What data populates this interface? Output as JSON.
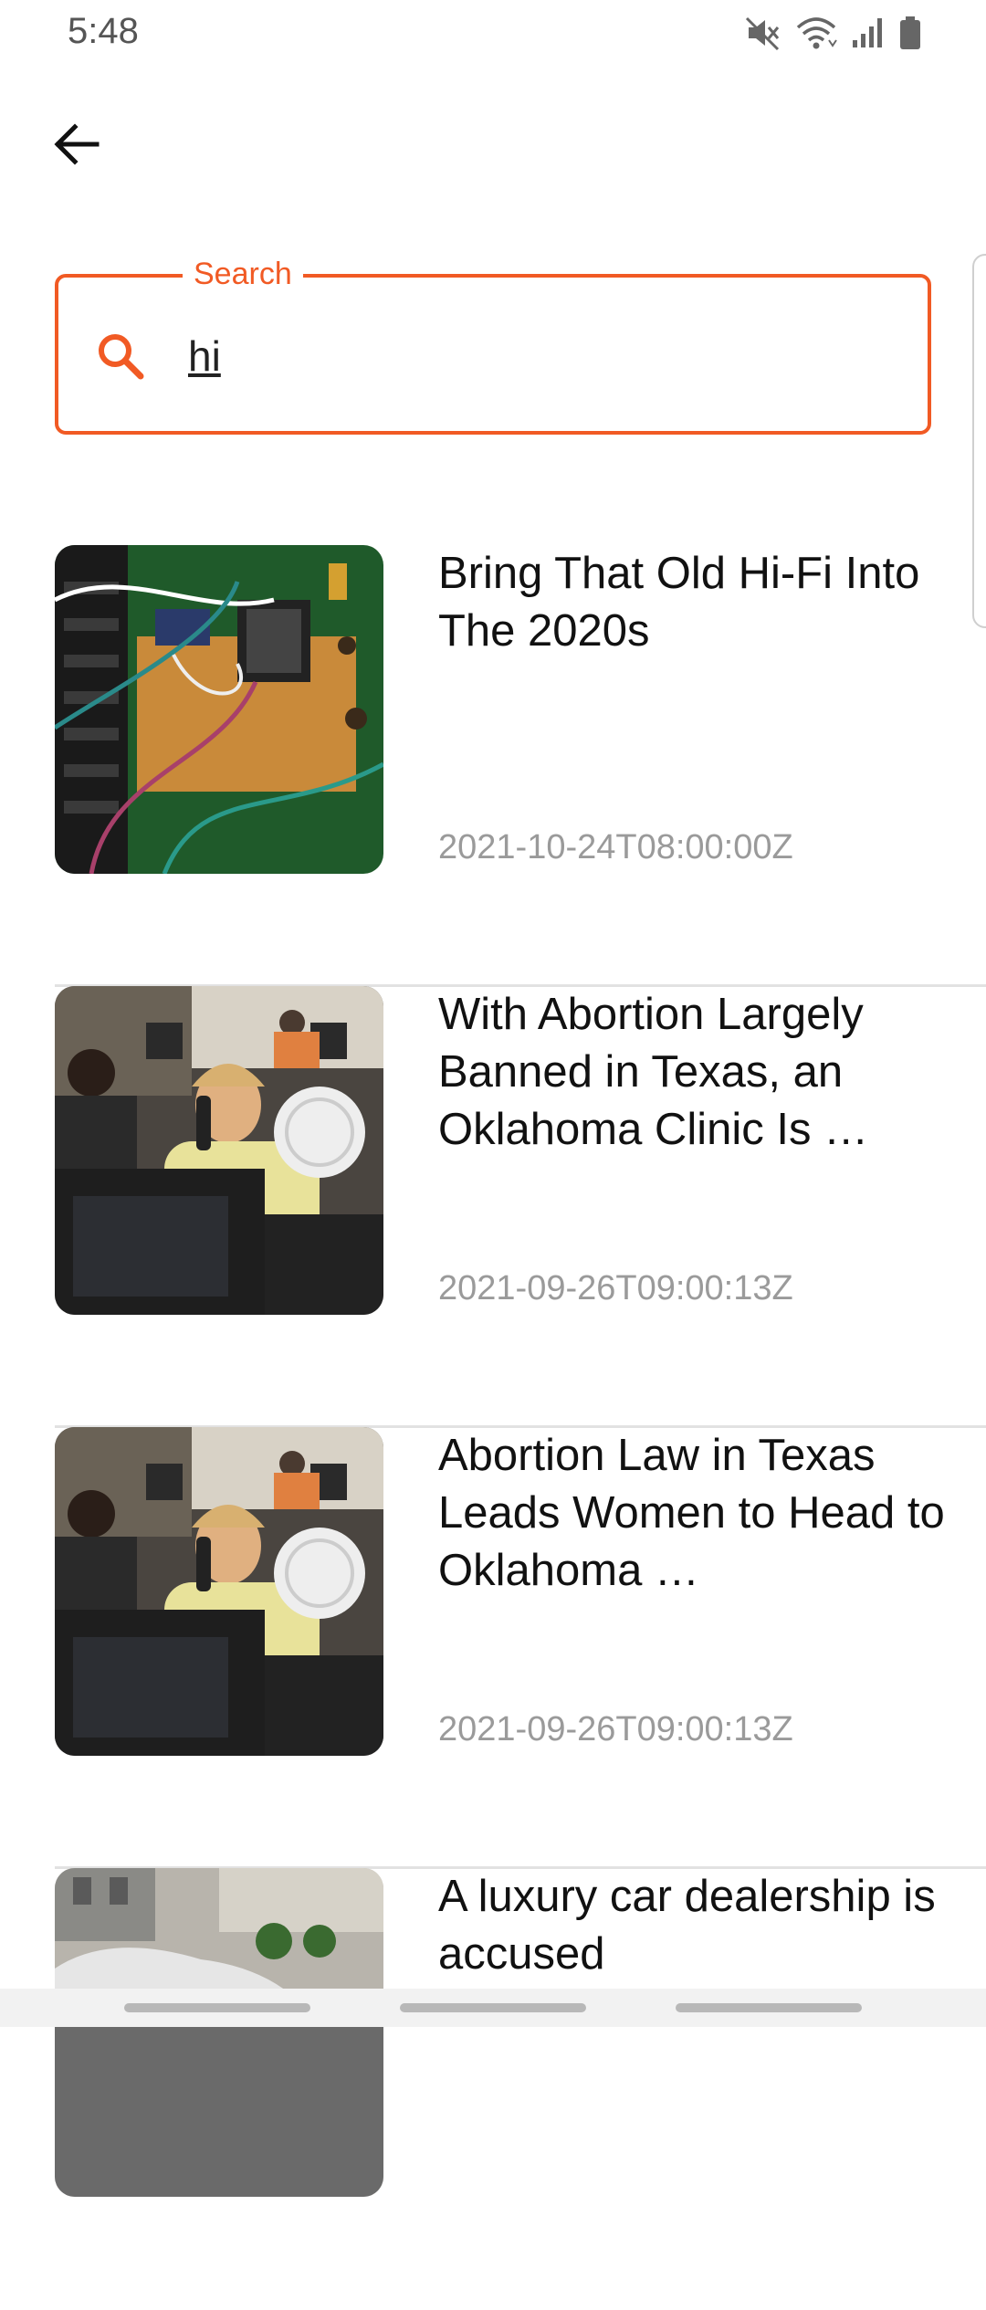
{
  "status_bar": {
    "time": "5:48",
    "icons": [
      "mute-icon",
      "wifi-icon",
      "signal-icon",
      "battery-icon"
    ]
  },
  "header": {
    "back_icon": "arrow-left-icon"
  },
  "search": {
    "label": "Search",
    "value": "hi",
    "icon": "search-icon",
    "accent_color": "#f15a24"
  },
  "articles": [
    {
      "title": "Bring That Old Hi-Fi Into The 2020s",
      "date": "2021-10-24T08:00:00Z",
      "image": "circuit-board-photo"
    },
    {
      "title": "With Abortion Largely Banned in Texas, an Oklahoma Clinic Is …",
      "date": "2021-09-26T09:00:13Z",
      "image": "clinic-phone-photo"
    },
    {
      "title": "Abortion Law in Texas Leads Women to Head to Oklahoma …",
      "date": "2021-09-26T09:00:13Z",
      "image": "clinic-phone-photo"
    },
    {
      "title": "A luxury car dealership is accused",
      "date": "",
      "image": "car-dealership-photo"
    }
  ]
}
